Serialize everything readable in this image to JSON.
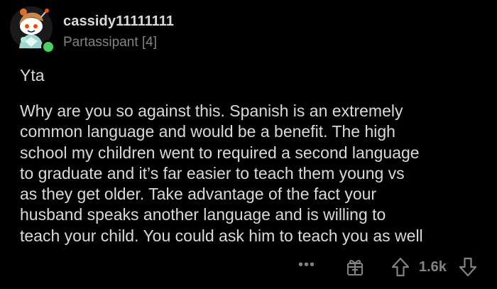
{
  "comment": {
    "author": {
      "username": "cassidy11111111",
      "flair": "Partassipant [4]",
      "avatar_icon": "snoo-avatar-icon",
      "online": true,
      "online_color": "#46d160"
    },
    "short_reply": "Yta",
    "body_lines": [
      "Why are you so against this. Spanish is an extremely",
      "common language and would be a benefit. The high",
      "school my children went to required a second language",
      "to graduate and it’s far easier to teach them young vs",
      "as they get older. Take advantage of the fact your",
      "husband speaks another language and is willing to",
      "teach your child. You could ask him to teach you as well"
    ],
    "actions": {
      "more_label": "•••",
      "award_icon": "gift-icon",
      "upvote_icon": "upvote-arrow-icon",
      "score": "1.6k",
      "downvote_icon": "downvote-arrow-icon"
    }
  },
  "theme": {
    "background": "#000000",
    "text": "#d7dadc",
    "muted": "#818384"
  }
}
